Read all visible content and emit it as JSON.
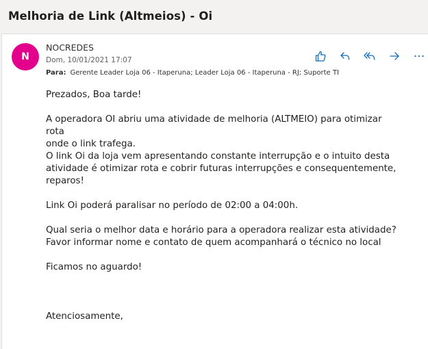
{
  "email": {
    "subject": "Melhoria de Link (Altmeios) - Oi",
    "avatar_initial": "N",
    "avatar_color": "#e3008c",
    "sender": "NOCREDES",
    "date": "Dom, 10/01/2021 17:07",
    "to_label": "Para:",
    "to_recipients": "Gerente Leader Loja 06 - Itaperuna; Leader Loja 06 - Itaperuna - RJ; Suporte TI",
    "accent_color": "#0f6cbd"
  },
  "actions": [
    {
      "icon": "like-icon"
    },
    {
      "icon": "reply-icon"
    },
    {
      "icon": "reply-all-icon"
    },
    {
      "icon": "forward-icon"
    },
    {
      "icon": "more-icon"
    }
  ],
  "body": {
    "greeting": "Prezados, Boa tarde!",
    "line1": "A operadora OI abriu uma atividade de melhoria (ALTMEIO) para otimizar rota",
    "line2": "onde o link trafega.",
    "line3": "O link Oi da loja vem apresentando constante interrupção e o intuito desta",
    "line4": "atividade é otimizar rota e cobrir futuras interrupções e consequentemente,",
    "line5": "reparos!",
    "line6": "Link Oi poderá paralisar no período de 02:00 a 04:00h.",
    "line7": "Qual seria o melhor data e horário para a operadora realizar esta atividade?",
    "line8": "Favor informar nome e contato de quem acompanhará o técnico no local",
    "line9": "Ficamos no aguardo!",
    "signoff": "Atenciosamente,"
  }
}
